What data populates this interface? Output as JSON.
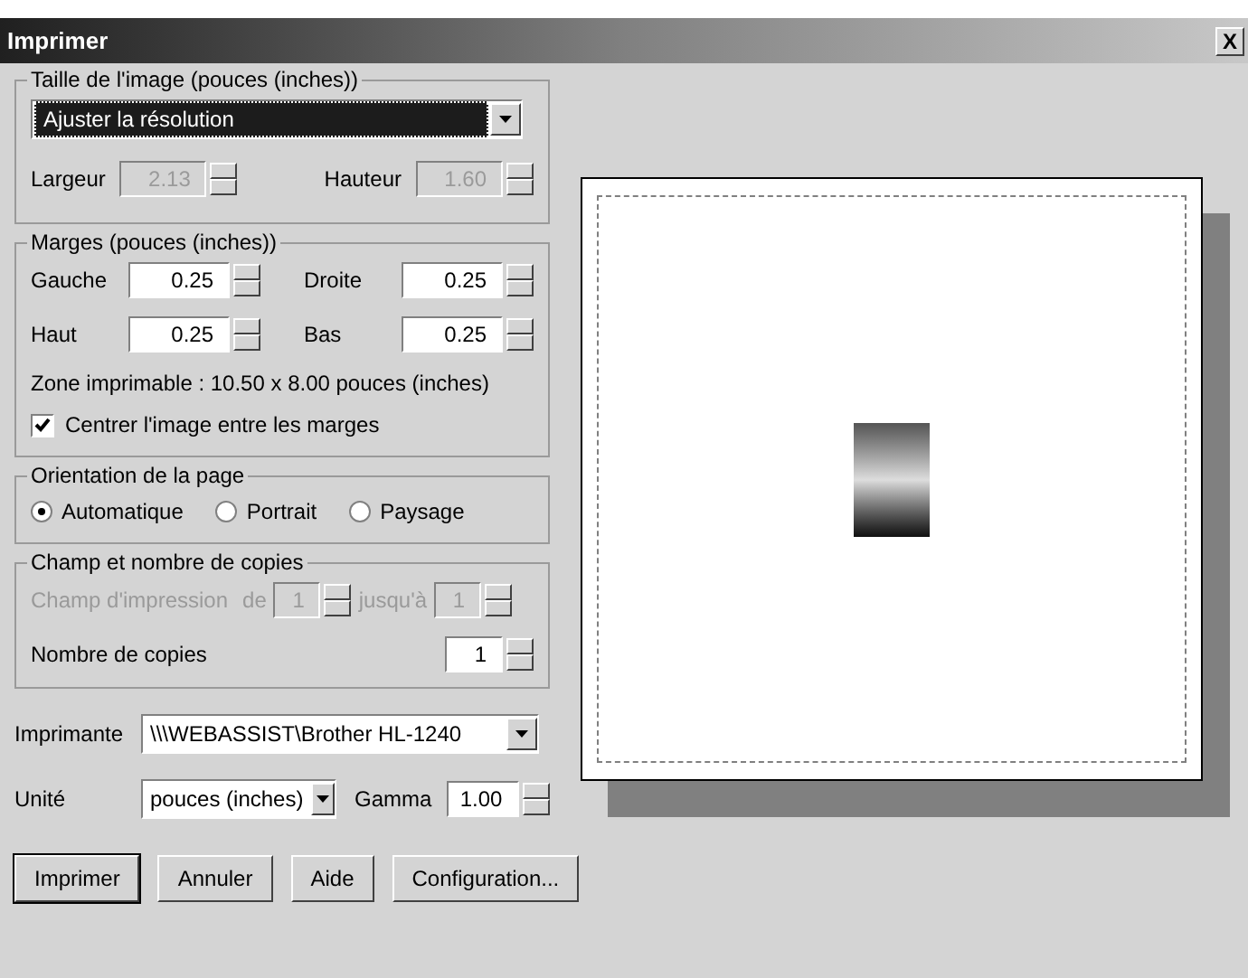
{
  "window": {
    "title": "Imprimer",
    "close": "X"
  },
  "image_size": {
    "legend": "Taille de l'image (pouces (inches))",
    "mode": "Ajuster la résolution",
    "fields": [
      {
        "label": "Largeur",
        "value": "2.13",
        "disabled": true
      },
      {
        "label": "Hauteur",
        "value": "1.60",
        "disabled": true
      }
    ]
  },
  "margins": {
    "legend": "Marges (pouces (inches))",
    "fields": [
      {
        "label": "Gauche",
        "value": "0.25",
        "disabled": false
      },
      {
        "label": "Droite",
        "value": "0.25",
        "disabled": false
      },
      {
        "label": "Haut",
        "value": "0.25",
        "disabled": false
      },
      {
        "label": "Bas",
        "value": "0.25",
        "disabled": false
      }
    ],
    "printable_area": "Zone imprimable : 10.50 x 8.00 pouces (inches)",
    "center": {
      "label": "Centrer l'image entre les marges",
      "checked": true
    }
  },
  "orientation": {
    "legend": "Orientation de la page",
    "options": [
      {
        "label": "Automatique",
        "selected": true
      },
      {
        "label": "Portrait",
        "selected": false
      },
      {
        "label": "Paysage",
        "selected": false
      }
    ]
  },
  "copies": {
    "legend": "Champ et nombre de copies",
    "range_label": "Champ d'impression",
    "range_disabled": true,
    "from": {
      "label": "de",
      "value": "1"
    },
    "to": {
      "label": "jusqu'à",
      "value": "1"
    },
    "count": {
      "label": "Nombre de copies",
      "value": "1"
    }
  },
  "printer": {
    "label": "Imprimante",
    "value": "\\\\\\WEBASSIST\\Brother HL-1240"
  },
  "unit": {
    "label": "Unité",
    "value": "pouces (inches)"
  },
  "gamma": {
    "label": "Gamma",
    "value": "1.00"
  },
  "buttons": [
    {
      "label": "Imprimer",
      "default": true
    },
    {
      "label": "Annuler",
      "default": false
    },
    {
      "label": "Aide",
      "default": false
    },
    {
      "label": "Configuration...",
      "default": false
    }
  ]
}
